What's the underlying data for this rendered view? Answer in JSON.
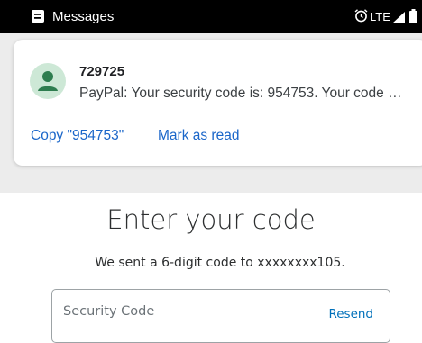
{
  "status_bar": {
    "app_name": "Messages",
    "network": "LTE",
    "icons": [
      "messages-icon",
      "alarm-icon",
      "signal-icon",
      "battery-icon"
    ]
  },
  "notification": {
    "sender": "729725",
    "preview": "PayPal: Your security code is: 954753. Your code …",
    "actions": {
      "copy": "Copy \"954753\"",
      "mark_read": "Mark as read"
    },
    "avatar_icon": "person-icon",
    "avatar_color": "#cde8d6",
    "avatar_fg": "#34a853",
    "action_color": "#1a66c9"
  },
  "page": {
    "title": "Enter your code",
    "subtitle": "We sent a 6-digit code to xxxxxxxx105.",
    "code_field": {
      "placeholder": "Security Code",
      "resend": "Resend"
    },
    "link_color": "#0070ba"
  }
}
